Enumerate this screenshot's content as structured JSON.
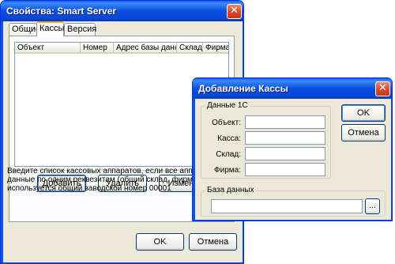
{
  "main_dialog": {
    "title": "Свойства: Smart Server",
    "close_glyph": "✕",
    "tabs": [
      {
        "label": "Общие",
        "active": false
      },
      {
        "label": "Кассы",
        "active": true
      },
      {
        "label": "Версия",
        "active": false
      }
    ],
    "columns": [
      "Объект",
      "Номер",
      "Адрес базы данных",
      "Склад",
      "Фирма"
    ],
    "buttons": {
      "add": "Добавить",
      "delete": "Удалить",
      "edit": "Измени"
    },
    "hint_lines": [
      "Введите список кассовых аппаратов, если все аппараты и",
      "данные по одним реквезитам (общий склад, фирма и т.д.),",
      "используется общий заводской номер 00001"
    ],
    "ok": "OK",
    "cancel": "Отмена"
  },
  "add_dialog": {
    "title": "Добавление Кассы",
    "close_glyph": "✕",
    "group_1c": {
      "label": "Данные 1С",
      "fields": [
        {
          "label": "Объект:",
          "value": ""
        },
        {
          "label": "Касса:",
          "value": ""
        },
        {
          "label": "Склад:",
          "value": ""
        },
        {
          "label": "Фирма:",
          "value": ""
        }
      ]
    },
    "group_db": {
      "label": "База данных",
      "value": "",
      "browse": "..."
    },
    "ok": "OK",
    "cancel": "Отмена"
  },
  "colors": {
    "title_blue": "#0a4ee0",
    "dialog_bg": "#ece9d8",
    "close_red": "#d8442a"
  }
}
